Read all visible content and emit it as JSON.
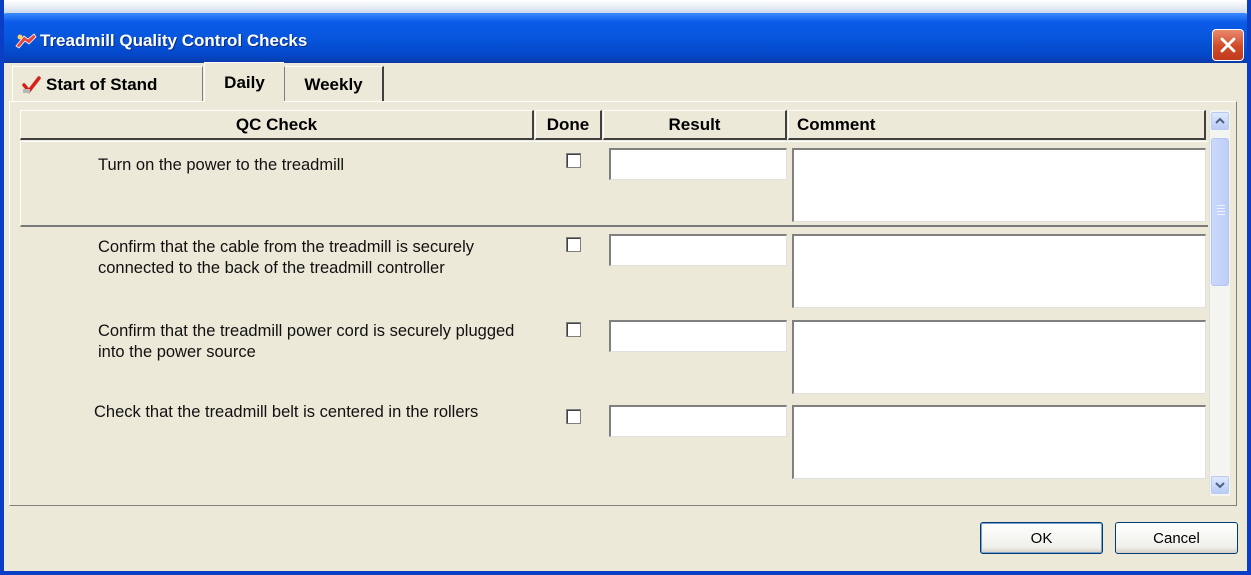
{
  "window": {
    "title": "Treadmill Quality Control Checks",
    "title_icon": "treadmill-app-icon",
    "close_icon": "close-x-icon",
    "accent_color": "#0756dc"
  },
  "tabs": [
    {
      "label": "Start of Stand",
      "completed": true,
      "icon": "red-checkmark-icon"
    },
    {
      "label": "Daily",
      "selected": true
    },
    {
      "label": "Weekly"
    }
  ],
  "grid": {
    "columns": [
      "QC Check",
      "Done",
      "Result",
      "Comment"
    ],
    "rows": [
      {
        "check": "Turn on the power to the treadmill",
        "done": false,
        "result": "",
        "comment": ""
      },
      {
        "check": "Confirm that the cable from the treadmill is securely connected to the back of the treadmill controller",
        "done": false,
        "result": "",
        "comment": ""
      },
      {
        "check": "Confirm that the treadmill power cord is securely plugged into the power source",
        "done": false,
        "result": "",
        "comment": ""
      },
      {
        "check": "Check that the treadmill belt is centered in the rollers",
        "done": false,
        "result": "",
        "comment": ""
      }
    ]
  },
  "buttons": {
    "ok": "OK",
    "cancel": "Cancel"
  }
}
